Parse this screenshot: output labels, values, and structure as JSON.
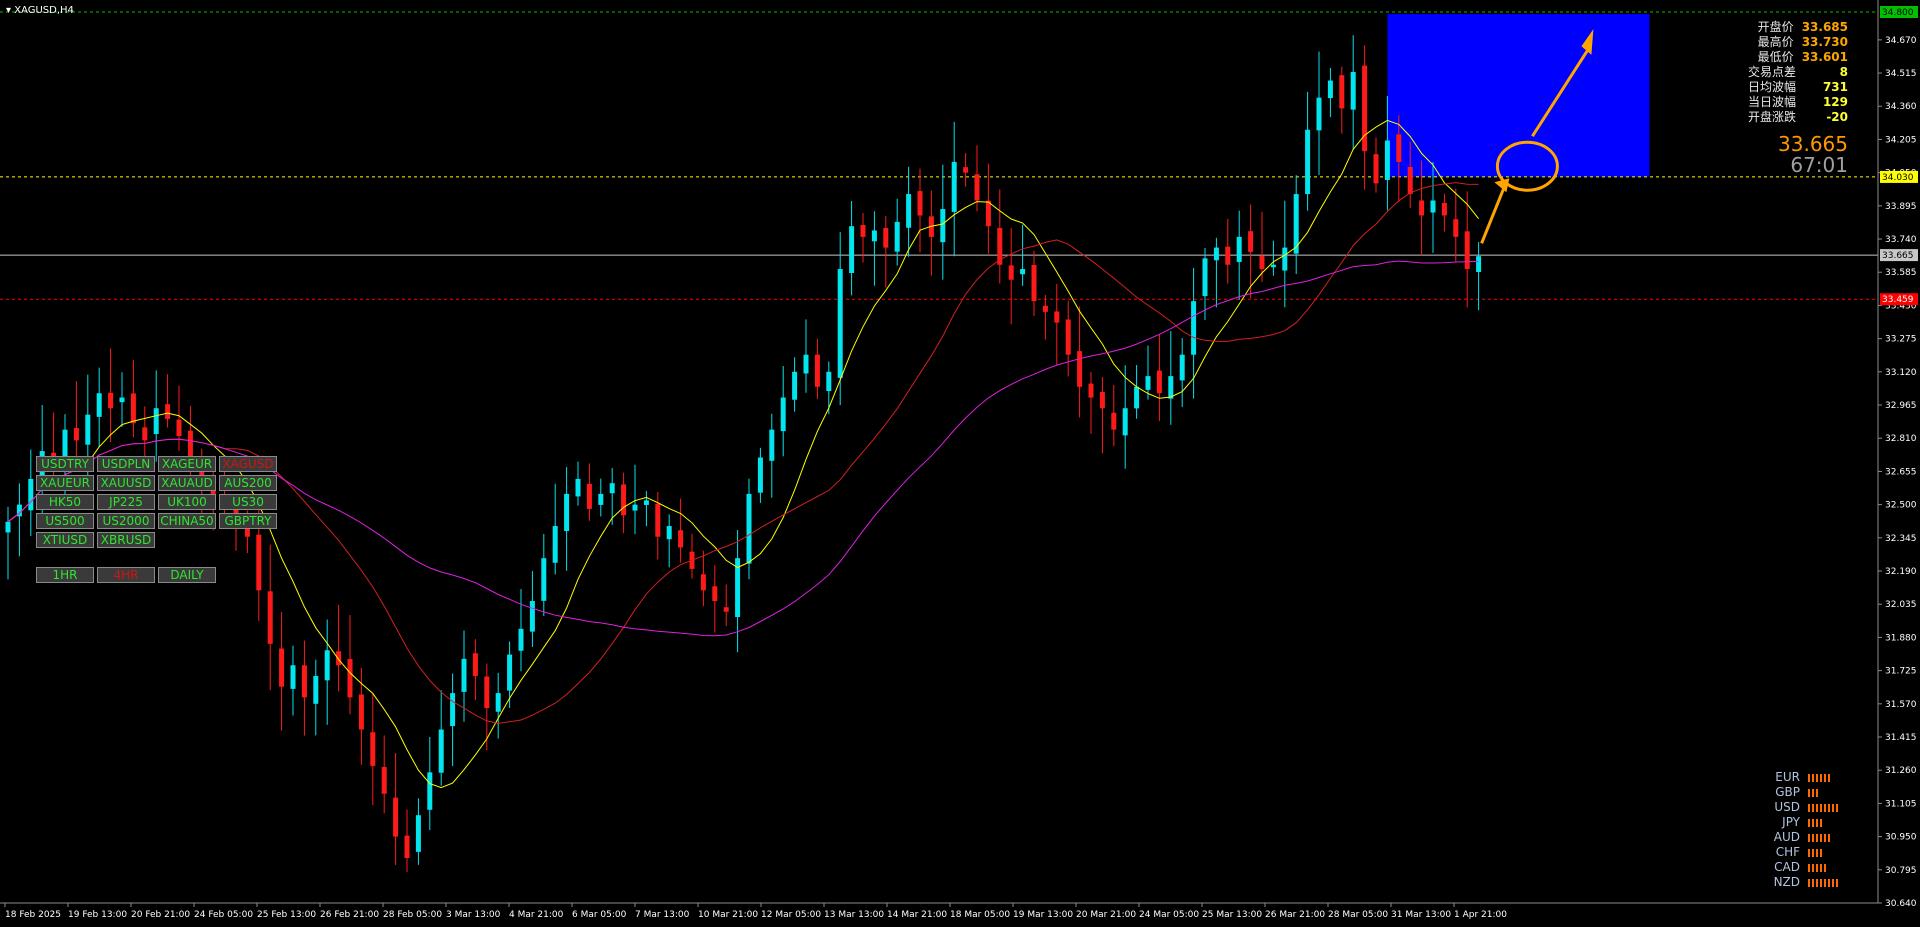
{
  "title": "XAGUSD,H4",
  "info": {
    "rows": [
      {
        "label": "开盘价",
        "value": "33.685",
        "color": "#ffa500"
      },
      {
        "label": "最高价",
        "value": "33.730",
        "color": "#ffa500"
      },
      {
        "label": "最低价",
        "value": "33.601",
        "color": "#ffa500"
      },
      {
        "label": "交易点差",
        "value": "8",
        "color": "#ffff33"
      },
      {
        "label": "日均波幅",
        "value": "731",
        "color": "#ffff33"
      },
      {
        "label": "当日波幅",
        "value": "129",
        "color": "#ffff33"
      },
      {
        "label": "开盘涨跌",
        "value": "-20",
        "color": "#ffff33"
      }
    ],
    "price": "33.665",
    "timer": "67:01"
  },
  "symbols": [
    [
      "USDTRY",
      "USDPLN",
      "XAGEUR",
      "XAGUSD"
    ],
    [
      "XAUEUR",
      "XAUUSD",
      "XAUAUD",
      "AUS200"
    ],
    [
      "HK50",
      "JP225",
      "UK100",
      "US30"
    ],
    [
      "US500",
      "US2000",
      "CHINA50",
      "GBPTRY"
    ],
    [
      "XTIUSD",
      "XBRUSD"
    ]
  ],
  "active_symbol": "XAGUSD",
  "timeframes": [
    "1HR",
    "4HR",
    "DAILY"
  ],
  "active_timeframe": "4HR",
  "currency_strength": [
    {
      "name": "EUR",
      "bars": 6
    },
    {
      "name": "GBP",
      "bars": 3
    },
    {
      "name": "USD",
      "bars": 8
    },
    {
      "name": "JPY",
      "bars": 4
    },
    {
      "name": "AUD",
      "bars": 6
    },
    {
      "name": "CHF",
      "bars": 4
    },
    {
      "name": "CAD",
      "bars": 5
    },
    {
      "name": "NZD",
      "bars": 8
    }
  ],
  "colors": {
    "bull": "#00e5ee",
    "bear": "#ff1a1a",
    "ma_fast": "#ffff00",
    "ma_mid": "#d22020",
    "ma_slow": "#e020e0",
    "box": "#0000ff",
    "arrow": "#ffa500"
  },
  "chart_data": {
    "type": "candlestick",
    "symbol": "XAGUSD",
    "timeframe": "H4",
    "y_ticks": [
      "34.670",
      "34.515",
      "34.360",
      "34.205",
      "34.050",
      "33.895",
      "33.740",
      "33.585",
      "33.430",
      "33.275",
      "33.120",
      "32.965",
      "32.810",
      "32.655",
      "32.500",
      "32.345",
      "32.190",
      "32.035",
      "31.880",
      "31.725",
      "31.570",
      "31.415",
      "31.260",
      "31.105",
      "30.950",
      "30.795",
      "30.640"
    ],
    "ylim": [
      30.64,
      34.8
    ],
    "x_ticks": [
      "18 Feb 2025",
      "19 Feb 13:00",
      "20 Feb 21:00",
      "24 Feb 05:00",
      "25 Feb 13:00",
      "26 Feb 21:00",
      "28 Feb 05:00",
      "3 Mar 13:00",
      "4 Mar 21:00",
      "6 Mar 05:00",
      "7 Mar 13:00",
      "10 Mar 21:00",
      "12 Mar 05:00",
      "13 Mar 13:00",
      "14 Mar 21:00",
      "18 Mar 05:00",
      "19 Mar 13:00",
      "20 Mar 21:00",
      "24 Mar 05:00",
      "25 Mar 13:00",
      "26 Mar 21:00",
      "28 Mar 05:00",
      "31 Mar 13:00",
      "1 Apr 21:00"
    ],
    "price_tags": [
      {
        "value": "34.800",
        "color": "#00c000"
      },
      {
        "value": "34.030",
        "color": "#ffff00"
      },
      {
        "value": "33.665",
        "color": "#c8c8c8"
      },
      {
        "value": "33.459",
        "color": "#ff0000"
      }
    ],
    "closes": [
      32.42,
      32.5,
      32.62,
      32.75,
      32.7,
      32.85,
      32.8,
      32.92,
      33.02,
      32.95,
      33.0,
      32.88,
      32.8,
      32.95,
      32.9,
      32.82,
      32.7,
      32.62,
      32.55,
      32.48,
      32.4,
      32.35,
      32.1,
      31.85,
      31.65,
      31.75,
      31.6,
      31.7,
      31.82,
      31.75,
      31.6,
      31.45,
      31.28,
      31.15,
      30.95,
      30.85,
      31.05,
      31.25,
      31.45,
      31.62,
      31.78,
      31.7,
      31.55,
      31.62,
      31.8,
      31.92,
      32.05,
      32.25,
      32.4,
      32.55,
      32.62,
      32.48,
      32.55,
      32.6,
      32.45,
      32.5,
      32.52,
      32.35,
      32.4,
      32.3,
      32.2,
      32.1,
      32.05,
      32.0,
      32.25,
      32.55,
      32.72,
      32.85,
      33.0,
      33.12,
      33.2,
      33.05,
      33.12,
      33.6,
      33.8,
      33.75,
      33.78,
      33.7,
      33.82,
      33.95,
      33.85,
      33.75,
      33.88,
      34.1,
      34.05,
      33.92,
      33.8,
      33.62,
      33.55,
      33.6,
      33.45,
      33.4,
      33.35,
      33.2,
      33.05,
      33.0,
      32.95,
      32.85,
      32.95,
      33.05,
      33.1,
      33.02,
      33.1,
      33.2,
      33.45,
      33.65,
      33.7,
      33.62,
      33.75,
      33.68,
      33.6,
      33.62,
      33.7,
      33.95,
      34.25,
      34.4,
      34.48,
      34.35,
      34.52,
      34.15,
      34.0,
      34.2,
      34.1,
      33.95,
      33.85,
      33.92,
      33.85,
      33.75,
      33.6,
      33.66
    ]
  }
}
